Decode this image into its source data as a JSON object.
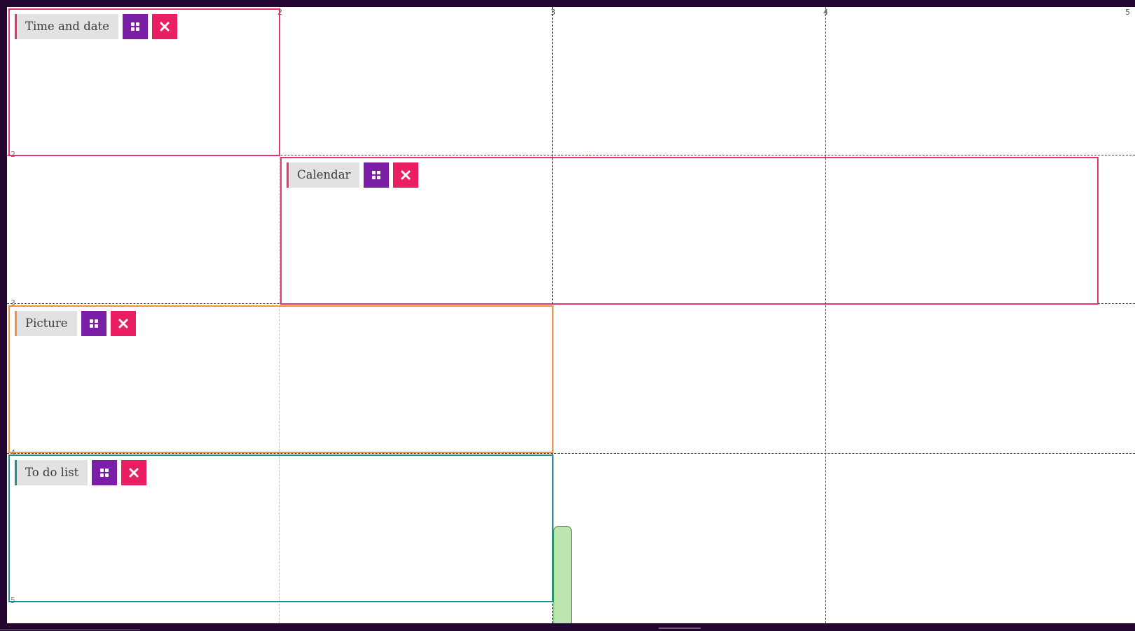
{
  "grid": {
    "column_labels": [
      "2",
      "3",
      "4",
      "5"
    ],
    "row_labels": [
      "2",
      "3",
      "4",
      "5"
    ]
  },
  "widgets": [
    {
      "title": "Time and date",
      "color": "#e8336f",
      "grid_icon": "grid-icon",
      "close_icon": "close-icon"
    },
    {
      "title": "Calendar",
      "color": "#e8336f",
      "grid_icon": "grid-icon",
      "close_icon": "close-icon"
    },
    {
      "title": "Picture",
      "color": "#f4913d",
      "grid_icon": "grid-icon",
      "close_icon": "close-icon"
    },
    {
      "title": "To do list",
      "color": "#1f8f93",
      "grid_icon": "grid-icon",
      "close_icon": "close-icon"
    }
  ],
  "colors": {
    "background": "#22062f",
    "board": "#ffffff",
    "grid_button": "#7a1ea5",
    "close_button": "#e91e63",
    "resize_handle": "#bde5b0"
  }
}
